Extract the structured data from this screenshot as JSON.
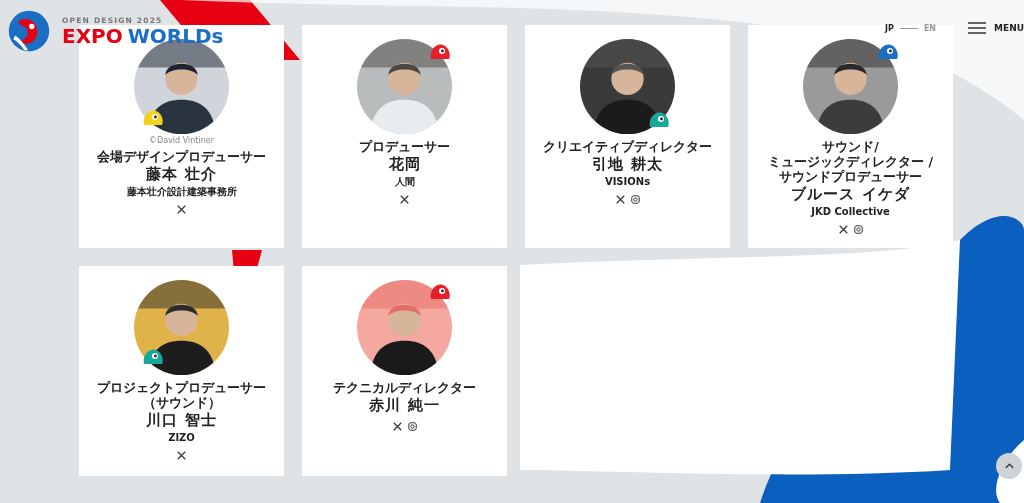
{
  "header": {
    "tagline": "OPEN DESIGN 2025",
    "logo_word_1": "EXPO",
    "logo_word_2": "WORLDs",
    "languages": [
      {
        "label": "JP",
        "selected": true
      },
      {
        "label": "EN",
        "selected": false
      }
    ],
    "menu": "MENU"
  },
  "members": [
    {
      "credit": "©David Vintiner",
      "role": "会場デザインプロデューサー",
      "name": "藤本 壮介",
      "org": "藤本壮介設計建築事務所",
      "socials": [
        {
          "kind": "x"
        }
      ],
      "color": "#f2d21b"
    },
    {
      "role": "プロデューサー",
      "name": "花岡",
      "org": "人間",
      "socials": [
        {
          "kind": "x"
        }
      ],
      "color": "#e5202b"
    },
    {
      "role": "クリエイティブディレクター",
      "name": "引地 耕太",
      "org": "VISIONs",
      "socials": [
        {
          "kind": "x"
        },
        {
          "kind": "instagram"
        }
      ],
      "color": "#17a89a"
    },
    {
      "role": "サウンド/ ミュージックディレクター / サウンドプロデューサー",
      "name": "ブルース イケダ",
      "org": "JKD Collective",
      "socials": [
        {
          "kind": "x"
        },
        {
          "kind": "instagram"
        }
      ],
      "color": "#1a6fc4"
    },
    {
      "role": "プロジェクトプロデューサー（サウンド）",
      "name": "川口 智士",
      "org": "ZIZO",
      "socials": [
        {
          "kind": "x"
        }
      ],
      "color": "#17a89a"
    },
    {
      "role": "テクニカルディレクター",
      "name": "赤川 純一",
      "socials": [
        {
          "kind": "x"
        },
        {
          "kind": "instagram"
        }
      ],
      "color": "#e5202b"
    }
  ]
}
